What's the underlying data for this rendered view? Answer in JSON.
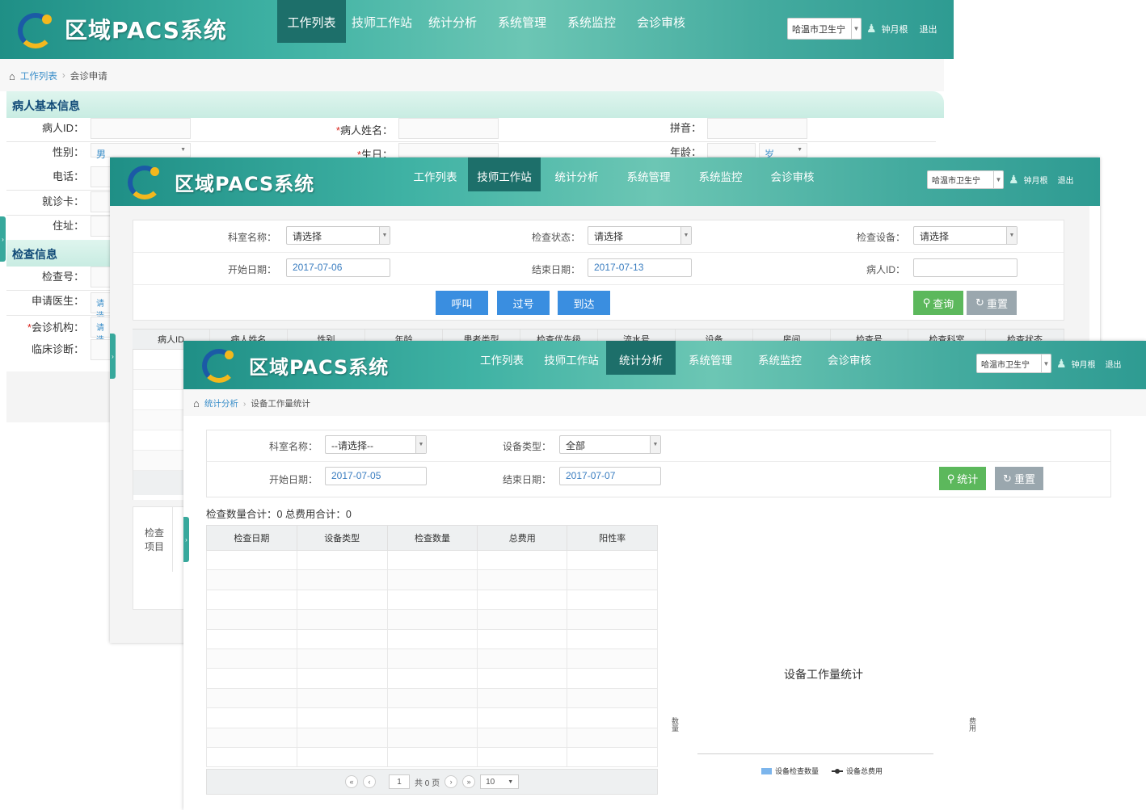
{
  "app": {
    "logo_text": "区域PACS系统",
    "nav": [
      "工作列表",
      "技师工作站",
      "统计分析",
      "系统管理",
      "系统监控",
      "会诊审核"
    ],
    "region": "哈温市卫生宁",
    "user": "钟月根",
    "logout": "退出",
    "brand_color": "#3fb2a4",
    "icons": [
      "home-icon",
      "user-icon",
      "search-icon",
      "refresh-icon",
      "caret-down-icon"
    ]
  },
  "win1": {
    "active_nav": "工作列表",
    "breadcrumb": {
      "link": "工作列表",
      "current": "会诊申请"
    },
    "section_patient": "病人基本信息",
    "section_exam": "检查信息",
    "labels": {
      "patient_id": "病人ID：",
      "patient_name": "病人姓名：",
      "pinyin": "拼音：",
      "gender": "性别：",
      "birth": "生日：",
      "age": "年龄：",
      "phone": "电话：",
      "card": "就诊卡：",
      "address": "住址：",
      "exam_no": "检查号：",
      "doctor": "申请医生：",
      "org": "会诊机构：",
      "diagnosis": "临床诊断："
    },
    "required_mark": "*",
    "gender_value": "男",
    "age_unit": "岁",
    "please_select_short": "请选"
  },
  "win2": {
    "active_nav": "技师工作站",
    "labels": {
      "dept": "科室名称：",
      "status": "检查状态：",
      "device": "检查设备：",
      "start": "开始日期：",
      "end": "结束日期：",
      "patient_id": "病人ID："
    },
    "dept_value": "请选择",
    "status_value": "请选择",
    "device_value": "请选择",
    "start_date": "2017-07-06",
    "end_date": "2017-07-13",
    "buttons": {
      "call": "呼叫",
      "skip": "过号",
      "arrive": "到达",
      "query": "查询",
      "reset": "重置"
    },
    "columns": [
      "病人ID",
      "病人姓名",
      "性别",
      "年龄",
      "患者类型",
      "检查优先级",
      "流水号",
      "设备",
      "房间",
      "检查号",
      "检查科室",
      "检查状态"
    ],
    "side_label": "检查项目"
  },
  "win3": {
    "active_nav": "统计分析",
    "breadcrumb": {
      "link": "统计分析",
      "current": "设备工作量统计"
    },
    "labels": {
      "dept": "科室名称：",
      "device_type": "设备类型：",
      "start": "开始日期：",
      "end": "结束日期："
    },
    "dept_value": "--请选择--",
    "device_type_value": "全部",
    "start_date": "2017-07-05",
    "end_date": "2017-07-07",
    "buttons": {
      "stat": "统计",
      "reset": "重置"
    },
    "summary": "检查数量合计：0 总费用合计：0",
    "columns": [
      "检查日期",
      "设备类型",
      "检查数量",
      "总费用",
      "阳性率"
    ],
    "pager": {
      "page": "1",
      "total": "共 0 页",
      "size": "10"
    },
    "chart_data": {
      "type": "bar",
      "title": "设备工作量统计",
      "ylabel": "数量",
      "y2label": "费用",
      "categories": [],
      "series": [
        {
          "name": "设备检查数量",
          "type": "bar",
          "values": []
        },
        {
          "name": "设备总费用",
          "type": "line",
          "values": []
        }
      ],
      "legend": "bottom",
      "grid": false
    }
  }
}
